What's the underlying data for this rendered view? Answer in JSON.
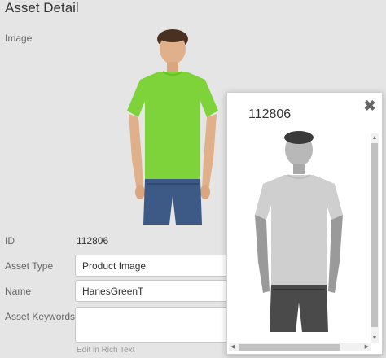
{
  "page": {
    "title": "Asset Detail"
  },
  "fields": {
    "image_label": "Image",
    "id_label": "ID",
    "id_value": "112806",
    "asset_type_label": "Asset Type",
    "asset_type_value": "Product Image",
    "name_label": "Name",
    "name_value": "HanesGreenT",
    "keywords_label": "Asset Keywords",
    "keywords_value": "",
    "rich_text_link": "Edit in Rich Text"
  },
  "popup": {
    "title": "112806",
    "close_icon": "close-icon"
  },
  "colors": {
    "shirt_main": "#7ed23a",
    "background": "#e5e5e5"
  }
}
